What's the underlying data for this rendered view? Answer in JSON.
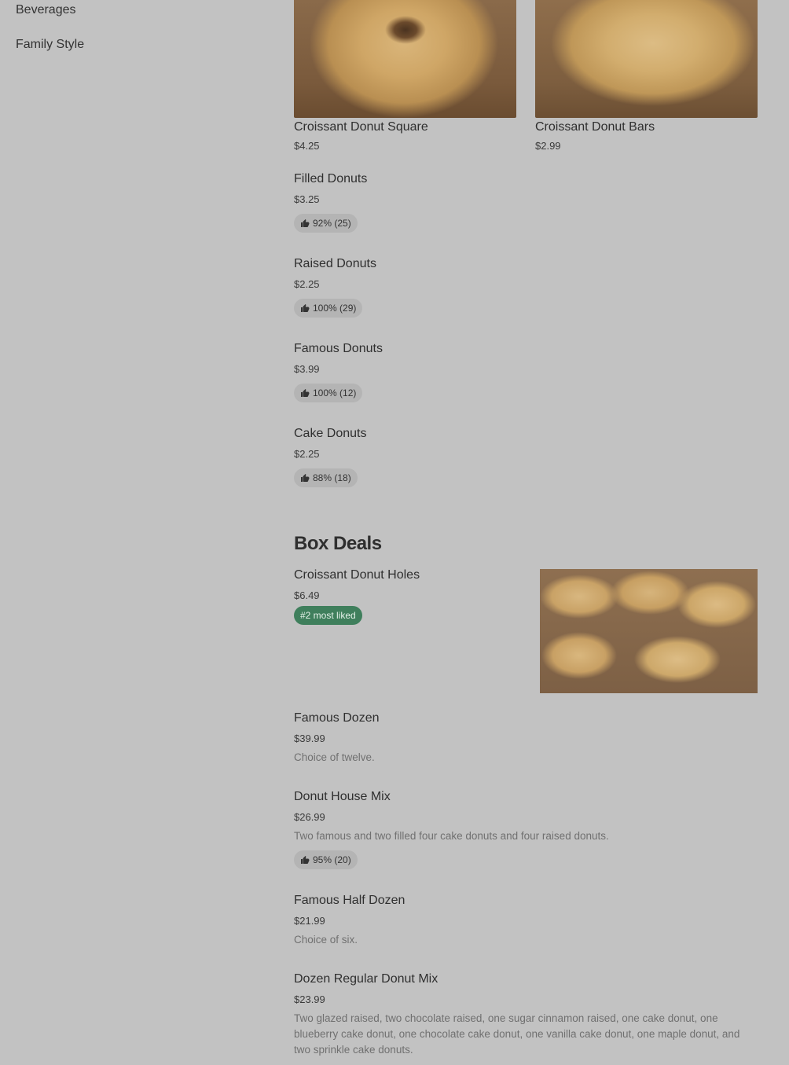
{
  "sidebar": {
    "items": [
      {
        "label": "Beverages"
      },
      {
        "label": "Family Style"
      }
    ]
  },
  "top_cards": [
    {
      "name": "Croissant Donut Square",
      "price": "$4.25"
    },
    {
      "name": "Croissant Donut Bars",
      "price": "$2.99"
    }
  ],
  "list_items": [
    {
      "name": "Filled Donuts",
      "price": "$3.25",
      "rating": "92% (25)"
    },
    {
      "name": "Raised Donuts",
      "price": "$2.25",
      "rating": "100% (29)"
    },
    {
      "name": "Famous Donuts",
      "price": "$3.99",
      "rating": "100% (12)"
    },
    {
      "name": "Cake Donuts",
      "price": "$2.25",
      "rating": "88% (18)"
    }
  ],
  "box_deals": {
    "title": "Box Deals",
    "featured": {
      "name": "Croissant Donut Holes",
      "price": "$6.49",
      "badge": "#2 most liked"
    },
    "items": [
      {
        "name": "Famous Dozen",
        "price": "$39.99",
        "description": "Choice of twelve."
      },
      {
        "name": "Donut House Mix",
        "price": "$26.99",
        "description": "Two famous and two filled four cake donuts and four raised donuts.",
        "rating": "95% (20)"
      },
      {
        "name": "Famous Half Dozen",
        "price": "$21.99",
        "description": "Choice of six."
      },
      {
        "name": "Dozen Regular Donut Mix",
        "price": "$23.99",
        "description": "Two glazed raised, two chocolate raised, one sugar cinnamon raised, one cake donut, one blueberry cake donut, one chocolate cake donut, one vanilla cake donut, one maple donut, and two sprinkle cake donuts."
      }
    ]
  }
}
